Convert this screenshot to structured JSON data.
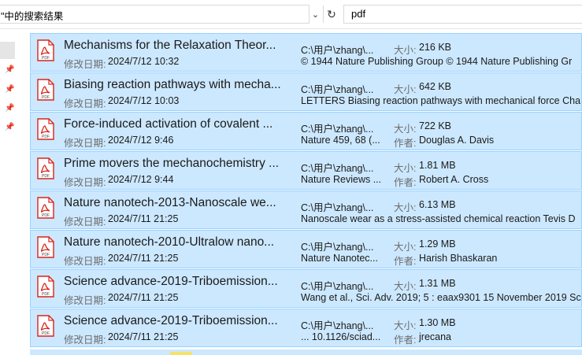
{
  "address": {
    "text": "\"中的搜索结果"
  },
  "search": {
    "value": "pdf"
  },
  "labels": {
    "modified": "修改日期:",
    "size": "大小:",
    "author": "作者:"
  },
  "colors": {
    "row_bg": "#cce8ff",
    "row_border": "#99d1ff",
    "pdf_red": "#d9241b"
  },
  "results": [
    {
      "title": "Mechanisms for the Relaxation Theor...",
      "date": "2024/7/12 10:32",
      "path": "C:\\用户\\zhang\\...",
      "size": "216 KB",
      "info": "© 1944 Nature Publishing Group © 1944 Nature Publishing Gr"
    },
    {
      "title": "Biasing reaction pathways with mecha...",
      "date": "2024/7/12 10:03",
      "path": "C:\\用户\\zhang\\...",
      "size": "642 KB",
      "info": "LETTERS Biasing reaction pathways with mechanical force Cha"
    },
    {
      "title": "Force-induced activation of covalent ...",
      "date": "2024/7/12 9:46",
      "path": "C:\\用户\\zhang\\...",
      "size": "722 KB",
      "info": "Nature 459, 68 (...",
      "author": "Douglas A. Davis"
    },
    {
      "title": "Prime movers the mechanochemistry ...",
      "date": "2024/7/12 9:44",
      "path": "C:\\用户\\zhang\\...",
      "size": "1.81 MB",
      "info": "Nature Reviews ...",
      "author": "Robert A. Cross"
    },
    {
      "title": "Nature nanotech-2013-Nanoscale we...",
      "date": "2024/7/11 21:25",
      "path": "C:\\用户\\zhang\\...",
      "size": "6.13 MB",
      "info": "Nanoscale wear as a stress-assisted chemical reaction Tevis D"
    },
    {
      "title": "Nature nanotech-2010-Ultralow nano...",
      "date": "2024/7/11 21:25",
      "path": "C:\\用户\\zhang\\...",
      "size": "1.29 MB",
      "info": "Nature Nanotec...",
      "author": "Harish Bhaskaran"
    },
    {
      "title": "Science advance-2019-Triboemission...",
      "date": "2024/7/11 21:25",
      "path": "C:\\用户\\zhang\\...",
      "size": "1.31 MB",
      "info": "Wang et al., Sci. Adv. 2019; 5 : eaax9301 15 November 2019 Sc"
    },
    {
      "title": "Science advance-2019-Triboemission...",
      "date": "2024/7/11 21:25",
      "path": "C:\\用户\\zhang\\...",
      "size": "1.30 MB",
      "info": "... 10.1126/sciad...",
      "author": "jrecana"
    }
  ]
}
